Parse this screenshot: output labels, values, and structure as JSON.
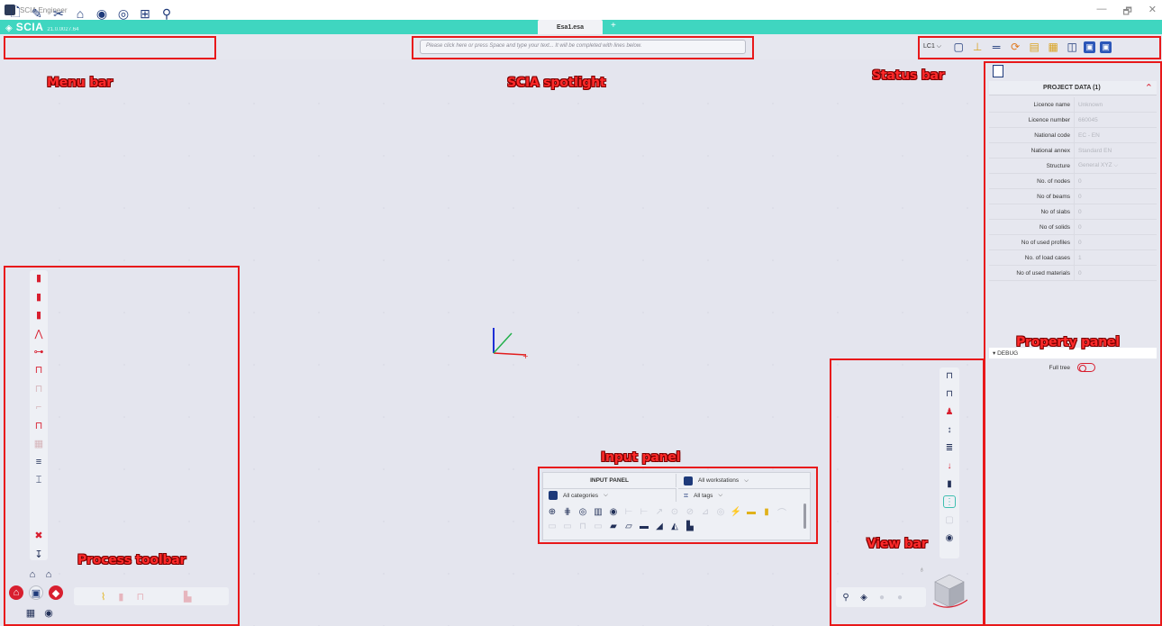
{
  "window": {
    "title": "SCIA Engineer",
    "controls": [
      "—",
      "🗗",
      "✕"
    ]
  },
  "brand": {
    "logo": "SCIA",
    "version": "21.0.0027.64"
  },
  "tabs": {
    "active": "Esa1.esa",
    "add": "+"
  },
  "menu_bar": {
    "icons": [
      "new-document-icon",
      "edit-document-icon",
      "tools-icon",
      "structure-icon",
      "model-icon",
      "view-icon",
      "library-icon",
      "search-icon"
    ]
  },
  "spotlight": {
    "placeholder": "Please click here or press Space and type your text... It will be completed with lines below."
  },
  "status_bar": {
    "load_case": "LC1",
    "icons": [
      "document-icon",
      "supports-icon",
      "beam-icon",
      "refresh-icon",
      "table-icon",
      "analysis-icon",
      "window-icon",
      "layout-icon",
      "layout2-icon"
    ]
  },
  "property_panel": {
    "title": "PROJECT DATA (1)",
    "rows": [
      {
        "key": "Licence name",
        "value": "Unknown"
      },
      {
        "key": "Licence number",
        "value": "660045"
      },
      {
        "key": "National code",
        "value": "EC - EN"
      },
      {
        "key": "National annex",
        "value": "Standard EN"
      },
      {
        "key": "Structure",
        "value": "General XYZ"
      },
      {
        "key": "No. of nodes",
        "value": "0"
      },
      {
        "key": "No of beams",
        "value": "0"
      },
      {
        "key": "No of slabs",
        "value": "0"
      },
      {
        "key": "No of solids",
        "value": "0"
      },
      {
        "key": "No of used profiles",
        "value": "0"
      },
      {
        "key": "No. of load cases",
        "value": "1"
      },
      {
        "key": "No of used materials",
        "value": "0"
      }
    ],
    "debug_label": "DEBUG",
    "full_tree_label": "Full tree"
  },
  "input_panel": {
    "title": "INPUT PANEL",
    "workstations": "All workstations",
    "categories": "All categories",
    "tags": "All tags"
  },
  "annotations": {
    "menu_bar": "Menu bar",
    "spotlight": "SCIA spotlight",
    "status_bar": "Status bar",
    "property_panel": "Property panel",
    "input_panel": "Input panel",
    "process_toolbar": "Process toolbar",
    "view_bar": "View bar"
  },
  "colors": {
    "accent": "#3fd6c0",
    "annotation": "#e8181a",
    "icon": "#1e3a7a",
    "process_icon": "#d81f2f"
  }
}
